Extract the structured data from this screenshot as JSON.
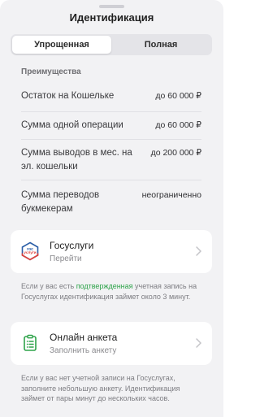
{
  "sheet": {
    "title": "Идентификация"
  },
  "tabs": [
    {
      "label": "Упрощенная",
      "active": true
    },
    {
      "label": "Полная",
      "active": false
    }
  ],
  "benefits": {
    "heading": "Преимущества",
    "rows": [
      {
        "label": "Остаток на Кошельке",
        "value": "до 60 000 ₽"
      },
      {
        "label": "Сумма одной операции",
        "value": "до 60 000 ₽"
      },
      {
        "label": "Сумма выводов в мес. на эл. кошельки",
        "value": "до 200 000 ₽"
      },
      {
        "label": "Сумма переводов букмекерам",
        "value": "неограниченно"
      }
    ]
  },
  "gosuslugi": {
    "title": "Госуслуги",
    "subtitle": "Перейти",
    "logo_line1": "гос",
    "logo_line2": "услуги",
    "note_before": "Если у вас есть ",
    "note_highlight": "подтвержденная",
    "note_after": " учетная запись на Госуслугах идентификация займет около 3 минут."
  },
  "online_form": {
    "title": "Онлайн анкета",
    "subtitle": "Заполнить анкету",
    "note": "Если у вас нет учетной записи на Госуслугах, заполните небольшую анкету. Идентификация займет от пары минут до нескольких часов."
  },
  "colors": {
    "accent_green": "#2ea34a",
    "gos_blue": "#2b5ea7",
    "gos_red": "#e0403a"
  },
  "icons": {
    "gosuslugi": "gosuslugi-logo",
    "form": "clipboard-icon",
    "chevron": "chevron-right-icon"
  }
}
